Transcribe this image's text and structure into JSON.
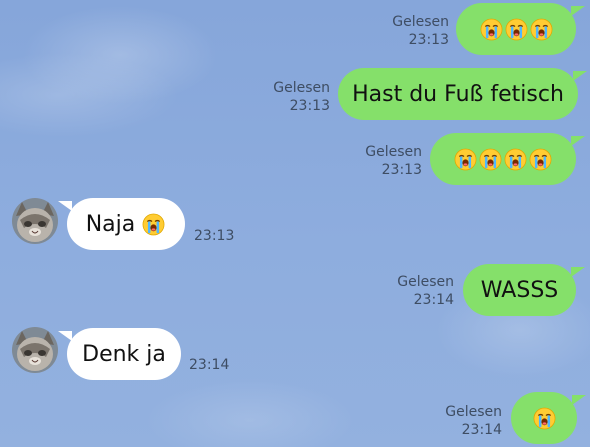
{
  "chat": {
    "read_label": "Gelesen",
    "messages": [
      {
        "direction": "out",
        "text": "",
        "emoji_count": 3,
        "time": "23:13",
        "read": "Gelesen"
      },
      {
        "direction": "out",
        "text": "Hast du Fuß fetisch",
        "emoji_count": 0,
        "time": "23:13",
        "read": "Gelesen"
      },
      {
        "direction": "out",
        "text": "",
        "emoji_count": 4,
        "time": "23:13",
        "read": "Gelesen"
      },
      {
        "direction": "in",
        "text": "Naja",
        "emoji_count": 1,
        "time": "23:13"
      },
      {
        "direction": "out",
        "text": "WASSS",
        "emoji_count": 0,
        "time": "23:14",
        "read": "Gelesen"
      },
      {
        "direction": "in",
        "text": "Denk ja",
        "emoji_count": 0,
        "time": "23:14"
      },
      {
        "direction": "out",
        "text": "",
        "emoji_count": 1,
        "time": "23:14",
        "read": "Gelesen"
      }
    ]
  },
  "colors": {
    "background": "#8aa9dc",
    "outgoing_bubble": "#85e06a",
    "incoming_bubble": "#ffffff",
    "meta_text": "#3e4d63"
  },
  "icons": {
    "emoji": "loudly-crying-face-icon",
    "avatar": "cat-avatar"
  }
}
